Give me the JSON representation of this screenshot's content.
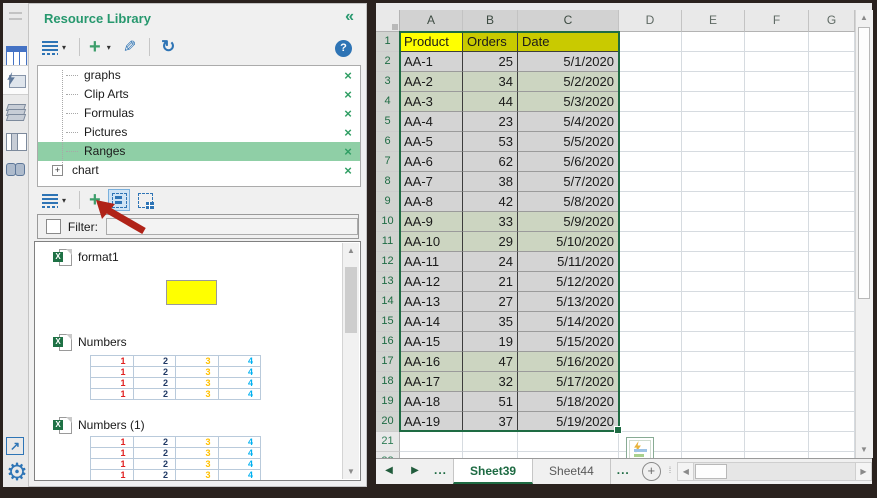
{
  "icons": {
    "collapse": "«",
    "dropdown": "▾",
    "help": "?",
    "refresh": "↻",
    "edit": "✎",
    "close": "×",
    "expand_node": "+",
    "up": "▲",
    "down": "▼",
    "left": "◀",
    "right": "▶",
    "external": "↗",
    "gear": "⚙",
    "excel_badge": "X",
    "add_sheet": "+"
  },
  "panel": {
    "title": "Resource Library",
    "tree": {
      "items": [
        {
          "label": "graphs",
          "selected": false,
          "expandable": false
        },
        {
          "label": "Clip Arts",
          "selected": false,
          "expandable": false
        },
        {
          "label": "Formulas",
          "selected": false,
          "expandable": false
        },
        {
          "label": "Pictures",
          "selected": false,
          "expandable": false
        },
        {
          "label": "Ranges",
          "selected": true,
          "expandable": false
        },
        {
          "label": "chart",
          "selected": false,
          "expandable": true
        }
      ]
    },
    "filter": {
      "label": "Filter:",
      "value": "",
      "checked": false
    },
    "library": {
      "items": [
        {
          "name": "format1",
          "preview": "swatch",
          "swatch_color": "#ffff00"
        },
        {
          "name": "Numbers",
          "preview": "table"
        },
        {
          "name": "Numbers (1)",
          "preview": "table"
        }
      ],
      "preview_table": {
        "values": [
          "1",
          "2",
          "3",
          "4"
        ],
        "colors": [
          "#e02020",
          "#1f3864",
          "#ffc000",
          "#00b0f0"
        ],
        "rows": 4
      }
    }
  },
  "spreadsheet": {
    "column_letters": [
      "A",
      "B",
      "C",
      "D",
      "E",
      "F",
      "G"
    ],
    "header_row": [
      "Product",
      "Orders",
      "Date"
    ],
    "data_rows": [
      [
        "AA-1",
        "25",
        "5/1/2020"
      ],
      [
        "AA-2",
        "34",
        "5/2/2020"
      ],
      [
        "AA-3",
        "44",
        "5/3/2020"
      ],
      [
        "AA-4",
        "23",
        "5/4/2020"
      ],
      [
        "AA-5",
        "53",
        "5/5/2020"
      ],
      [
        "AA-6",
        "62",
        "5/6/2020"
      ],
      [
        "AA-7",
        "38",
        "5/7/2020"
      ],
      [
        "AA-8",
        "42",
        "5/8/2020"
      ],
      [
        "AA-9",
        "33",
        "5/9/2020"
      ],
      [
        "AA-10",
        "29",
        "5/10/2020"
      ],
      [
        "AA-11",
        "24",
        "5/11/2020"
      ],
      [
        "AA-12",
        "21",
        "5/12/2020"
      ],
      [
        "AA-13",
        "27",
        "5/13/2020"
      ],
      [
        "AA-14",
        "35",
        "5/14/2020"
      ],
      [
        "AA-15",
        "19",
        "5/15/2020"
      ],
      [
        "AA-16",
        "47",
        "5/16/2020"
      ],
      [
        "AA-17",
        "32",
        "5/17/2020"
      ],
      [
        "AA-18",
        "51",
        "5/18/2020"
      ],
      [
        "AA-19",
        "37",
        "5/19/2020"
      ]
    ],
    "weekend_row_indices": [
      1,
      2,
      8,
      9,
      15,
      16
    ],
    "visible_row_count": 22,
    "colors": {
      "header_active": "#ffff00",
      "header_selected": "#c9ca00",
      "row_selected": "#d4d4d4",
      "row_weekend": "#ccd5c1",
      "selection_border": "#1e6b43"
    }
  },
  "tabs": {
    "prev_ellipsis": "...",
    "sheets": [
      {
        "label": "Sheet39",
        "active": true
      },
      {
        "label": "Sheet44",
        "active": false
      }
    ],
    "next_ellipsis": "..."
  }
}
